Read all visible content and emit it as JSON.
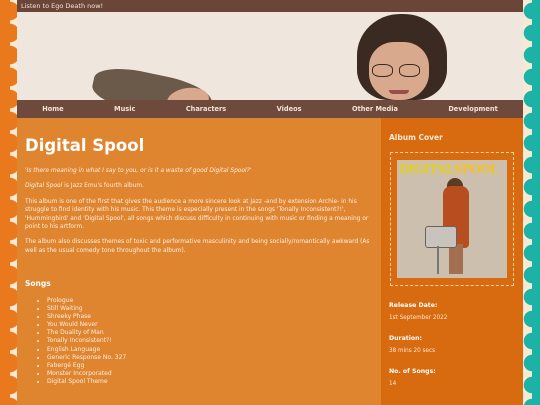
{
  "topbar": {
    "text": "Listen to Ego Death now!"
  },
  "nav": {
    "items": [
      "Home",
      "Music",
      "Characters",
      "Videos",
      "Other Media",
      "Development"
    ]
  },
  "main": {
    "title": "Digital Spool",
    "quote": "'Is there meaning in what I say to you, or is it a waste of good Digital Spool?'",
    "intro_title": "Digital Spool",
    "intro_rest": " is Jazz Emu's fourth album.",
    "para1": "This album is one of the first that gives the audience a more sincere look at Jazz -and by extension Archie- in his struggle to find identity with his music. This theme is especially present in the songs 'Tonally Inconsistent?!', 'Hummingbird' and 'Digital Spool', all songs which discuss difficulty in continuing with music or finding a meaning or point to his artform.",
    "para2": "The album also discusses themes of toxic and performative masculinity and being socially/romantically awkward (As well as the usual comedy tone throughout the album).",
    "songs_heading": "Songs",
    "songs": [
      "Prologue",
      "Still Waiting",
      "Shreeky Phase",
      "You Would Never",
      "The Duality of Man",
      "Tonally Inconsistent?!",
      "English Language",
      "Generic Response No. 327",
      "Fabergé Egg",
      "Monster Incorporated",
      "Digital Spool Theme"
    ]
  },
  "aside": {
    "cover_heading": "Album Cover",
    "cover_text_main": "DIGITAL",
    "cover_text_second": "SPOOL",
    "release_label": "Release Date:",
    "release_value": "1st September 2022",
    "duration_label": "Duration:",
    "duration_value": "38 mins 20 secs",
    "songs_label": "No. of Songs:",
    "songs_value": "14"
  },
  "colors": {
    "main_bg": "#e0852f",
    "aside_bg": "#d86a0f",
    "nav_bg": "#6e4a3c",
    "left_border": "#e9791c",
    "right_border": "#1db2a6"
  }
}
